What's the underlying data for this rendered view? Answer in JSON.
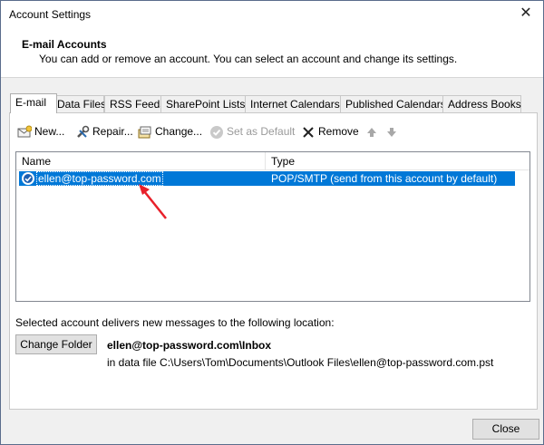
{
  "window": {
    "title": "Account Settings",
    "close_glyph": "✕"
  },
  "header": {
    "title": "E-mail Accounts",
    "description": "You can add or remove an account. You can select an account and change its settings."
  },
  "tabs": [
    {
      "label": "E-mail",
      "active": true
    },
    {
      "label": "Data Files"
    },
    {
      "label": "RSS Feeds"
    },
    {
      "label": "SharePoint Lists"
    },
    {
      "label": "Internet Calendars"
    },
    {
      "label": "Published Calendars"
    },
    {
      "label": "Address Books"
    }
  ],
  "toolbar": {
    "new_label": "New...",
    "repair_label": "Repair...",
    "change_label": "Change...",
    "set_default_label": "Set as Default",
    "remove_label": "Remove"
  },
  "list": {
    "columns": [
      "Name",
      "Type"
    ],
    "rows": [
      {
        "name": "ellen@top-password.com",
        "type": "POP/SMTP (send from this account by default)"
      }
    ]
  },
  "delivery": {
    "label": "Selected account delivers new messages to the following location:",
    "change_folder_label": "Change Folder",
    "folder_path": "ellen@top-password.com\\Inbox",
    "data_file": "in data file C:\\Users\\Tom\\Documents\\Outlook Files\\ellen@top-password.com.pst"
  },
  "footer": {
    "close_label": "Close"
  },
  "colors": {
    "selection": "#0078d7",
    "annotation_arrow": "#e8202a"
  }
}
